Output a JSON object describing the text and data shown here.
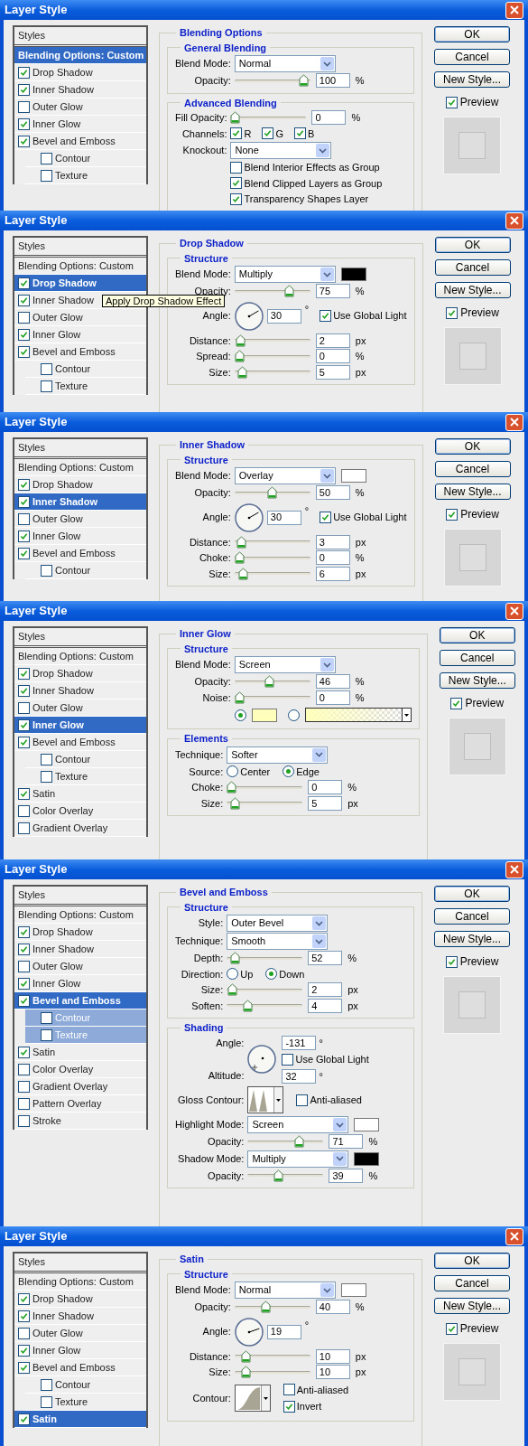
{
  "dialogs": [
    {
      "title": "Layer Style",
      "styles_header": "Styles",
      "buttons": [
        "OK",
        "Cancel",
        "New Style..."
      ],
      "preview": {
        "label": "Preview",
        "checked": true
      },
      "section_title": "Blending Options",
      "styles": [
        {
          "kind": "options",
          "label": "Blending Options: Custom",
          "selected": true
        },
        {
          "kind": "effect",
          "label": "Drop Shadow",
          "checked": true,
          "selected": false
        },
        {
          "kind": "effect",
          "label": "Inner Shadow",
          "checked": true,
          "selected": false
        },
        {
          "kind": "effect",
          "label": "Outer Glow",
          "checked": false,
          "selected": false
        },
        {
          "kind": "effect",
          "label": "Inner Glow",
          "checked": true,
          "selected": false
        },
        {
          "kind": "effect",
          "label": "Bevel and Emboss",
          "checked": true,
          "selected": false,
          "children": [
            {
              "kind": "effect",
              "label": "Contour",
              "checked": false,
              "selected": false
            },
            {
              "kind": "effect",
              "label": "Texture",
              "checked": false,
              "selected": false
            }
          ]
        }
      ],
      "groups": [
        {
          "title": "General Blending",
          "rows": [
            {
              "kind": "select",
              "label": "Blend Mode:",
              "value": "Normal"
            },
            {
              "kind": "slider",
              "label": "Opacity:",
              "level": 0.98,
              "value": "100",
              "unit": "%"
            }
          ]
        },
        {
          "title": "Advanced Blending",
          "rows": [
            {
              "kind": "slider",
              "label": "Fill Opacity:",
              "level": 0,
              "value": "0",
              "unit": "%"
            },
            {
              "kind": "checks",
              "label": "Channels:",
              "items": [
                {
                  "label": "R",
                  "checked": true
                },
                {
                  "label": "G",
                  "checked": true
                },
                {
                  "label": "B",
                  "checked": true
                }
              ]
            },
            {
              "kind": "select",
              "label": "Knockout:",
              "value": "None"
            },
            {
              "kind": "check",
              "label": "Blend Interior Effects as Group",
              "checked": false
            },
            {
              "kind": "check",
              "label": "Blend Clipped Layers as Group",
              "checked": true
            },
            {
              "kind": "check",
              "label": "Transparency Shapes Layer",
              "checked": true
            }
          ]
        }
      ]
    },
    {
      "title": "Layer Style",
      "styles_header": "Styles",
      "buttons": [
        "OK",
        "Cancel",
        "New Style..."
      ],
      "preview": {
        "label": "Preview",
        "checked": true
      },
      "section_title": "Drop Shadow",
      "tooltip": "Apply Drop Shadow Effect",
      "styles": [
        {
          "kind": "options",
          "label": "Blending Options: Custom",
          "selected": false
        },
        {
          "kind": "effect",
          "label": "Drop Shadow",
          "checked": true,
          "selected": true
        },
        {
          "kind": "effect",
          "label": "Inner Shadow",
          "checked": true,
          "selected": false
        },
        {
          "kind": "effect",
          "label": "Outer Glow",
          "checked": false,
          "selected": false
        },
        {
          "kind": "effect",
          "label": "Inner Glow",
          "checked": true,
          "selected": false
        },
        {
          "kind": "effect",
          "label": "Bevel and Emboss",
          "checked": true,
          "selected": false,
          "children": [
            {
              "kind": "effect",
              "label": "Contour",
              "checked": false,
              "selected": false
            },
            {
              "kind": "effect",
              "label": "Texture",
              "checked": false,
              "selected": false
            }
          ]
        }
      ],
      "groups": [
        {
          "title": "Structure",
          "rows": [
            {
              "kind": "select",
              "label": "Blend Mode:",
              "value": "Multiply",
              "color": "#000000"
            },
            {
              "kind": "slider",
              "label": "Opacity:",
              "level": 0.75,
              "value": "75",
              "unit": "%"
            },
            {
              "kind": "angle",
              "label": "Angle:",
              "value": "30",
              "unit": "°",
              "checkbox": {
                "label": "Use Global Light",
                "checked": true
              }
            },
            {
              "kind": "slider",
              "label": "Distance:",
              "level": 0.02,
              "value": "2",
              "unit": "px"
            },
            {
              "kind": "slider",
              "label": "Spread:",
              "level": 0,
              "value": "0",
              "unit": "%"
            },
            {
              "kind": "slider",
              "label": "Size:",
              "level": 0.05,
              "value": "5",
              "unit": "px"
            }
          ]
        }
      ]
    },
    {
      "title": "Layer Style",
      "styles_header": "Styles",
      "buttons": [
        "OK",
        "Cancel",
        "New Style..."
      ],
      "preview": {
        "label": "Preview",
        "checked": true
      },
      "section_title": "Inner Shadow",
      "styles": [
        {
          "kind": "options",
          "label": "Blending Options: Custom",
          "selected": false
        },
        {
          "kind": "effect",
          "label": "Drop Shadow",
          "checked": true,
          "selected": false
        },
        {
          "kind": "effect",
          "label": "Inner Shadow",
          "checked": true,
          "selected": true
        },
        {
          "kind": "effect",
          "label": "Outer Glow",
          "checked": false,
          "selected": false
        },
        {
          "kind": "effect",
          "label": "Inner Glow",
          "checked": true,
          "selected": false
        },
        {
          "kind": "effect",
          "label": "Bevel and Emboss",
          "checked": true,
          "selected": false,
          "children": [
            {
              "kind": "effect",
              "label": "Contour",
              "checked": false,
              "selected": false
            }
          ]
        }
      ],
      "groups": [
        {
          "title": "Structure",
          "rows": [
            {
              "kind": "select",
              "label": "Blend Mode:",
              "value": "Overlay",
              "color": "#ffffff"
            },
            {
              "kind": "slider",
              "label": "Opacity:",
              "level": 0.5,
              "value": "50",
              "unit": "%"
            },
            {
              "kind": "angle",
              "label": "Angle:",
              "value": "30",
              "unit": "°",
              "checkbox": {
                "label": "Use Global Light",
                "checked": true
              }
            },
            {
              "kind": "slider",
              "label": "Distance:",
              "level": 0.03,
              "value": "3",
              "unit": "px"
            },
            {
              "kind": "slider",
              "label": "Choke:",
              "level": 0,
              "value": "0",
              "unit": "%"
            },
            {
              "kind": "slider",
              "label": "Size:",
              "level": 0.06,
              "value": "6",
              "unit": "px"
            }
          ]
        }
      ]
    },
    {
      "title": "Layer Style",
      "styles_header": "Styles",
      "buttons": [
        "OK",
        "Cancel",
        "New Style..."
      ],
      "preview": {
        "label": "Preview",
        "checked": true
      },
      "section_title": "Inner Glow",
      "styles": [
        {
          "kind": "options",
          "label": "Blending Options: Custom",
          "selected": false
        },
        {
          "kind": "effect",
          "label": "Drop Shadow",
          "checked": true,
          "selected": false
        },
        {
          "kind": "effect",
          "label": "Inner Shadow",
          "checked": true,
          "selected": false
        },
        {
          "kind": "effect",
          "label": "Outer Glow",
          "checked": false,
          "selected": false
        },
        {
          "kind": "effect",
          "label": "Inner Glow",
          "checked": true,
          "selected": true
        },
        {
          "kind": "effect",
          "label": "Bevel and Emboss",
          "checked": true,
          "selected": false,
          "children": [
            {
              "kind": "effect",
              "label": "Contour",
              "checked": false,
              "selected": false
            },
            {
              "kind": "effect",
              "label": "Texture",
              "checked": false,
              "selected": false
            }
          ]
        },
        {
          "kind": "effect",
          "label": "Satin",
          "checked": true,
          "selected": false
        },
        {
          "kind": "effect",
          "label": "Color Overlay",
          "checked": false,
          "selected": false
        },
        {
          "kind": "effect",
          "label": "Gradient Overlay",
          "checked": false,
          "selected": false
        }
      ],
      "groups": [
        {
          "title": "Structure",
          "rows": [
            {
              "kind": "select",
              "label": "Blend Mode:",
              "value": "Screen"
            },
            {
              "kind": "slider",
              "label": "Opacity:",
              "level": 0.46,
              "value": "46",
              "unit": "%"
            },
            {
              "kind": "slider",
              "label": "Noise:",
              "level": 0,
              "value": "0",
              "unit": "%"
            },
            {
              "kind": "fill",
              "options": [
                {
                  "kind": "solid",
                  "selected": true,
                  "color": "#ffffbb"
                },
                {
                  "kind": "gradient",
                  "selected": false,
                  "color": "#ffffbb"
                }
              ]
            }
          ]
        },
        {
          "title": "Elements",
          "rows": [
            {
              "kind": "select",
              "label": "Technique:",
              "value": "Softer"
            },
            {
              "kind": "radios",
              "label": "Source:",
              "options": [
                {
                  "label": "Center",
                  "selected": false
                },
                {
                  "label": "Edge",
                  "selected": true
                }
              ]
            },
            {
              "kind": "slider",
              "label": "Choke:",
              "level": 0,
              "value": "0",
              "unit": "%"
            },
            {
              "kind": "slider",
              "label": "Size:",
              "level": 0.05,
              "value": "5",
              "unit": "px"
            }
          ]
        }
      ]
    },
    {
      "title": "Layer Style",
      "styles_header": "Styles",
      "buttons": [
        "OK",
        "Cancel",
        "New Style..."
      ],
      "preview": {
        "label": "Preview",
        "checked": true
      },
      "section_title": "Bevel and Emboss",
      "styles": [
        {
          "kind": "options",
          "label": "Blending Options: Custom",
          "selected": false
        },
        {
          "kind": "effect",
          "label": "Drop Shadow",
          "checked": true,
          "selected": false
        },
        {
          "kind": "effect",
          "label": "Inner Shadow",
          "checked": true,
          "selected": false
        },
        {
          "kind": "effect",
          "label": "Outer Glow",
          "checked": false,
          "selected": false
        },
        {
          "kind": "effect",
          "label": "Inner Glow",
          "checked": true,
          "selected": false
        },
        {
          "kind": "effect",
          "label": "Bevel and Emboss",
          "checked": true,
          "selected": true,
          "children": [
            {
              "kind": "effect",
              "label": "Contour",
              "checked": false,
              "selected": false
            },
            {
              "kind": "effect",
              "label": "Texture",
              "checked": false,
              "selected": false
            }
          ]
        },
        {
          "kind": "effect",
          "label": "Satin",
          "checked": true,
          "selected": false
        },
        {
          "kind": "effect",
          "label": "Color Overlay",
          "checked": false,
          "selected": false
        },
        {
          "kind": "effect",
          "label": "Gradient Overlay",
          "checked": false,
          "selected": false
        },
        {
          "kind": "effect",
          "label": "Pattern Overlay",
          "checked": false,
          "selected": false
        },
        {
          "kind": "effect",
          "label": "Stroke",
          "checked": false,
          "selected": false
        }
      ],
      "groups": [
        {
          "title": "Structure",
          "rows": [
            {
              "kind": "select",
              "label": "Style:",
              "value": "Outer Bevel"
            },
            {
              "kind": "select",
              "label": "Technique:",
              "value": "Smooth"
            },
            {
              "kind": "slider",
              "label": "Depth:",
              "level": 0.05,
              "value": "52",
              "unit": "%"
            },
            {
              "kind": "radios",
              "label": "Direction:",
              "options": [
                {
                  "label": "Up",
                  "selected": false
                },
                {
                  "label": "Down",
                  "selected": true
                }
              ]
            },
            {
              "kind": "slider",
              "label": "Size:",
              "level": 0.01,
              "value": "2",
              "unit": "px"
            },
            {
              "kind": "slider",
              "label": "Soften:",
              "level": 0.25,
              "value": "4",
              "unit": "px"
            }
          ]
        },
        {
          "title": "Shading",
          "rows": [
            {
              "kind": "shading",
              "label": "Angle:",
              "value": "-131",
              "unit": "°",
              "checkbox": {
                "label": "Use Global Light",
                "checked": false
              },
              "altitude": {
                "label": "Altitude:",
                "value": "32",
                "unit": "°"
              }
            },
            {
              "kind": "contour",
              "label": "Gloss Contour:",
              "thumbnail": {
                "kind": "gloss"
              },
              "checks": [
                {
                  "label": "Anti-aliased",
                  "checked": false
                }
              ]
            },
            {
              "kind": "select",
              "label": "Highlight Mode:",
              "value": "Screen",
              "color": "#ffffff"
            },
            {
              "kind": "slider",
              "label": "Opacity:",
              "level": 0.71,
              "value": "71",
              "unit": "%"
            },
            {
              "kind": "select",
              "label": "Shadow Mode:",
              "value": "Multiply",
              "color": "#000000"
            },
            {
              "kind": "slider",
              "label": "Opacity:",
              "level": 0.39,
              "value": "39",
              "unit": "%"
            }
          ]
        }
      ]
    },
    {
      "title": "Layer Style",
      "styles_header": "Styles",
      "buttons": [
        "OK",
        "Cancel",
        "New Style..."
      ],
      "preview": {
        "label": "Preview",
        "checked": true
      },
      "section_title": "Satin",
      "styles": [
        {
          "kind": "options",
          "label": "Blending Options: Custom",
          "selected": false
        },
        {
          "kind": "effect",
          "label": "Drop Shadow",
          "checked": true,
          "selected": false
        },
        {
          "kind": "effect",
          "label": "Inner Shadow",
          "checked": true,
          "selected": false
        },
        {
          "kind": "effect",
          "label": "Outer Glow",
          "checked": false,
          "selected": false
        },
        {
          "kind": "effect",
          "label": "Inner Glow",
          "checked": true,
          "selected": false
        },
        {
          "kind": "effect",
          "label": "Bevel and Emboss",
          "checked": true,
          "selected": false,
          "children": [
            {
              "kind": "effect",
              "label": "Contour",
              "checked": false,
              "selected": false
            },
            {
              "kind": "effect",
              "label": "Texture",
              "checked": false,
              "selected": false
            }
          ]
        },
        {
          "kind": "effect",
          "label": "Satin",
          "checked": true,
          "selected": true
        }
      ],
      "groups": [
        {
          "title": "Structure",
          "rows": [
            {
              "kind": "select",
              "label": "Blend Mode:",
              "value": "Normal",
              "color": "#ffffff"
            },
            {
              "kind": "slider",
              "label": "Opacity:",
              "level": 0.4,
              "value": "40",
              "unit": "%"
            },
            {
              "kind": "angle",
              "label": "Angle:",
              "value": "19",
              "unit": "°"
            },
            {
              "kind": "slider",
              "label": "Distance:",
              "level": 0.1,
              "value": "10",
              "unit": "px"
            },
            {
              "kind": "slider",
              "label": "Size:",
              "level": 0.1,
              "value": "10",
              "unit": "px"
            },
            {
              "kind": "contour",
              "label": "Contour:",
              "thumbnail": {
                "kind": "curve"
              },
              "checks": [
                {
                  "label": "Anti-aliased",
                  "checked": false
                },
                {
                  "label": "Invert",
                  "checked": true
                }
              ]
            }
          ]
        }
      ]
    }
  ]
}
